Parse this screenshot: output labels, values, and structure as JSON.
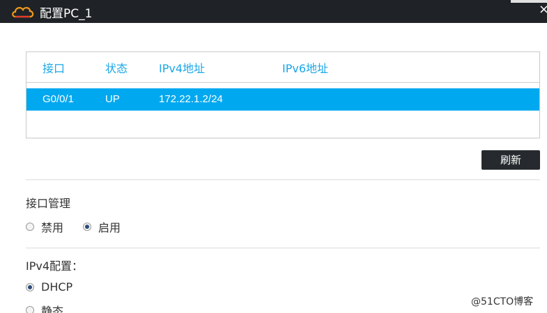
{
  "window": {
    "title": "配置PC_1",
    "close_glyph": "×"
  },
  "table": {
    "columns": [
      "接口",
      "状态",
      "IPv4地址",
      "IPv6地址"
    ],
    "rows": [
      {
        "interface": "G0/0/1",
        "status": "UP",
        "ipv4": "172.22.1.2/24",
        "ipv6": ""
      }
    ],
    "header_color": "#1aa7e6",
    "selected_row_color": "#00a8f0"
  },
  "refresh_button": {
    "label": "刷新"
  },
  "interface_management": {
    "label": "接口管理",
    "options": [
      {
        "label": "禁用",
        "selected": false
      },
      {
        "label": "启用",
        "selected": true
      }
    ]
  },
  "ipv4_config": {
    "label": "IPv4配置：",
    "options": [
      {
        "label": "DHCP",
        "selected": true
      },
      {
        "label": "静态",
        "selected": false
      }
    ]
  },
  "watermark": {
    "text": "@51CTO博客"
  }
}
